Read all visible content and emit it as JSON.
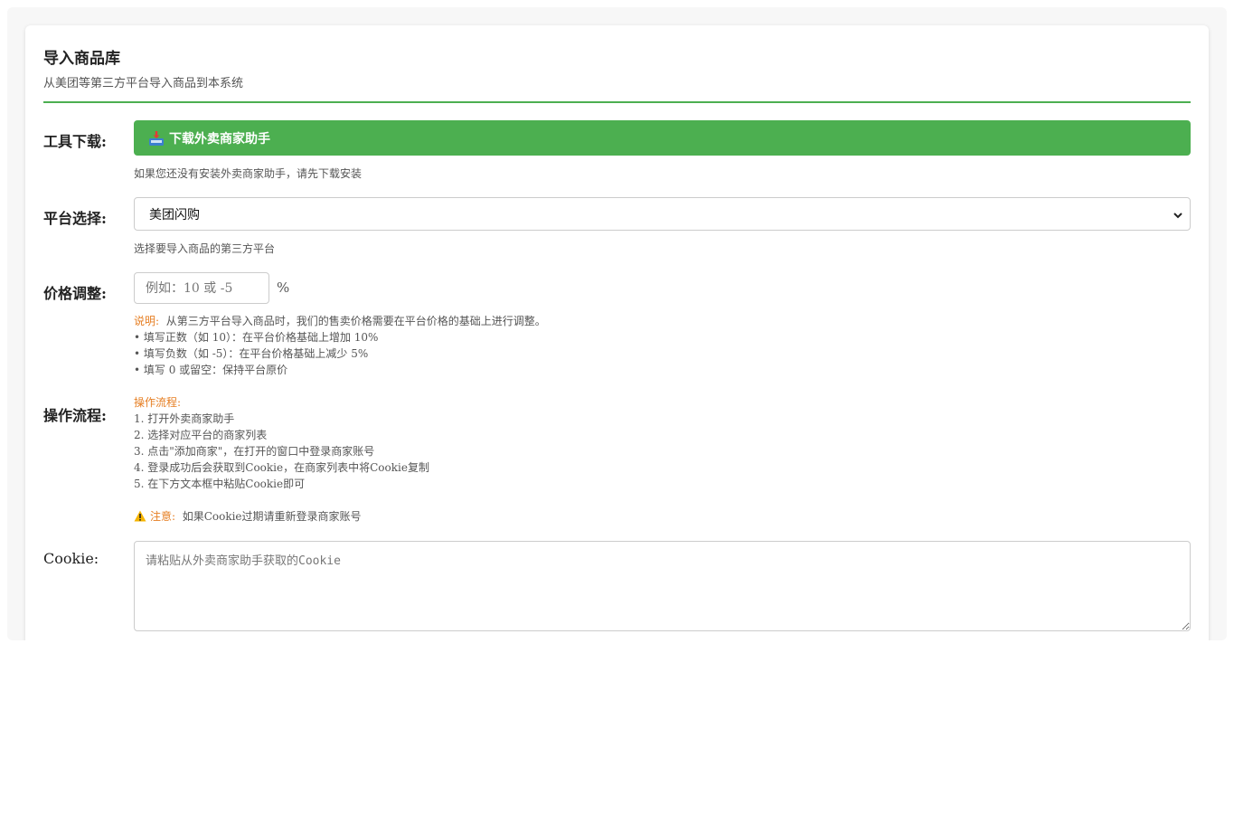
{
  "header": {
    "title": "导入商品库",
    "subtitle": "从美团等第三方平台导入商品到本系统"
  },
  "tool_download": {
    "label": "工具下载:",
    "button_label": "下载外卖商家助手",
    "button_icon": "download-tray-icon",
    "hint": "如果您还没有安装外卖商家助手，请先下载安装"
  },
  "platform": {
    "label": "平台选择:",
    "selected": "美团闪购",
    "hint": "选择要导入商品的第三方平台"
  },
  "price": {
    "label": "价格调整:",
    "placeholder": "例如：10 或 -5",
    "unit": "%",
    "note_title": "说明:",
    "note_text": "从第三方平台导入商品时，我们的售卖价格需要在平台价格的基础上进行调整。",
    "rules": [
      "• 填写正数（如 10）：在平台价格基础上增加 10%",
      "• 填写负数（如 -5）：在平台价格基础上减少 5%",
      "• 填写 0 或留空：保持平台原价"
    ]
  },
  "process": {
    "label": "操作流程:",
    "title": "操作流程:",
    "steps": [
      "1. 打开外卖商家助手",
      "2. 选择对应平台的商家列表",
      "3. 点击\"添加商家\"，在打开的窗口中登录商家账号",
      "4. 登录成功后会获取到Cookie，在商家列表中将Cookie复制",
      "5. 在下方文本框中粘贴Cookie即可"
    ],
    "warning_title": "注意:",
    "warning_text": "如果Cookie过期请重新登录商家账号"
  },
  "cookie": {
    "label": "Cookie:",
    "placeholder": "请粘贴从外卖商家助手获取的Cookie"
  },
  "colors": {
    "accent": "#4caf50",
    "note": "#e67e22",
    "warning": "#f5b400"
  }
}
